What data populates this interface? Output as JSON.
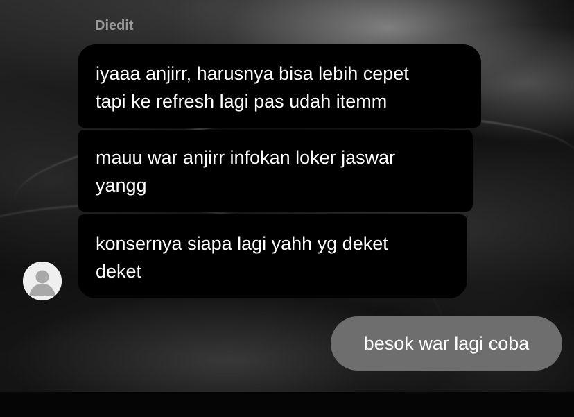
{
  "chat": {
    "edited_label": "Diedit",
    "received_messages": [
      {
        "lines": [
          "iyaaa anjirr, harusnya bisa lebih cepet",
          "tapi ke refresh lagi pas udah itemm"
        ]
      },
      {
        "lines": [
          "mauu war anjirr infokan loker jaswar",
          "yangg"
        ]
      },
      {
        "lines": [
          "konsernya siapa lagi yahh yg deket",
          "deket"
        ]
      }
    ],
    "sent_message": "besok war lagi coba",
    "avatar_icon": "default-profile-icon",
    "colors": {
      "received_bubble": "#000000",
      "sent_bubble": "#6e6e6e",
      "text": "#ffffff",
      "edited_label": "#9a9a9a"
    }
  }
}
